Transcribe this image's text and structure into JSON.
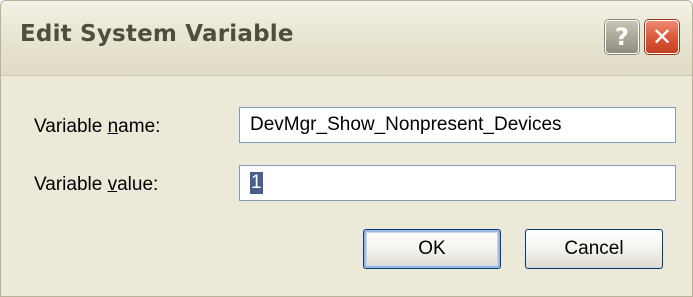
{
  "dialog": {
    "title": "Edit System Variable",
    "help_glyph": "?",
    "close_glyph": "✕"
  },
  "fields": {
    "name": {
      "label_pre": "Variable ",
      "label_access": "n",
      "label_post": "ame:",
      "value": "DevMgr_Show_Nonpresent_Devices"
    },
    "value": {
      "label_pre": "Variable ",
      "label_access": "v",
      "label_post": "alue:",
      "value": "1"
    }
  },
  "buttons": {
    "ok": "OK",
    "cancel": "Cancel"
  },
  "icons": {
    "help": "help-icon",
    "close": "close-icon"
  },
  "colors": {
    "window_bg": "#ece9d8",
    "close_red": "#dc5a3c",
    "selection": "#4a5e8c",
    "input_border": "#7f9db9"
  }
}
